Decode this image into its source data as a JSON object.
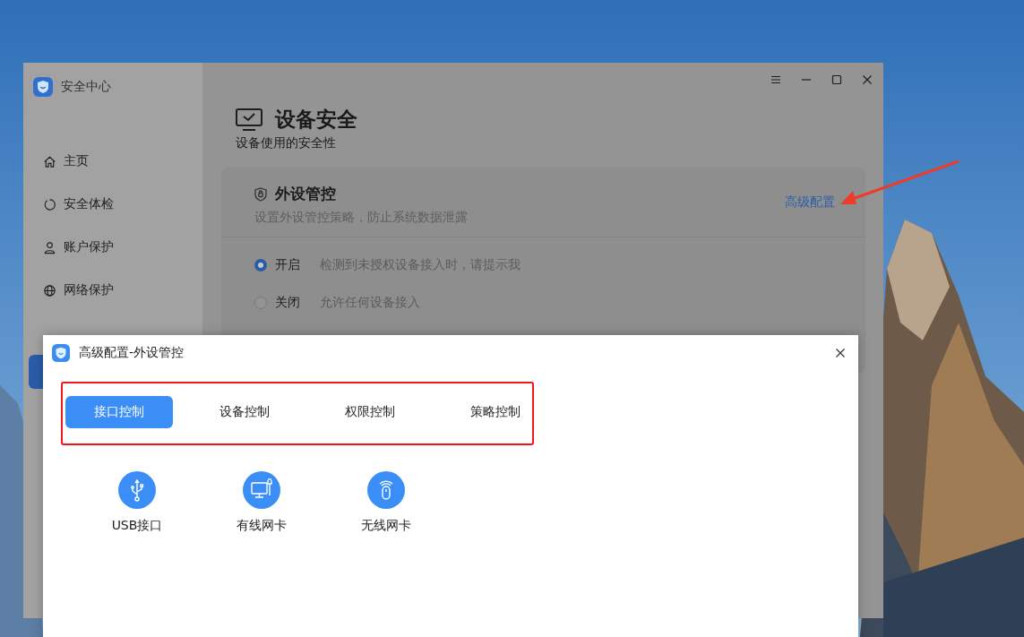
{
  "window": {
    "title": "安全中心"
  },
  "sidebar": {
    "items": [
      {
        "label": "主页"
      },
      {
        "label": "安全体检"
      },
      {
        "label": "账户保护"
      },
      {
        "label": "网络保护"
      }
    ]
  },
  "page": {
    "title": "设备安全",
    "subtitle": "设备使用的安全性"
  },
  "card": {
    "title": "外设管控",
    "description": "设置外设管控策略，防止系统数据泄露",
    "link": "高级配置",
    "options": [
      {
        "label": "开启",
        "hint": "检测到未授权设备接入时，请提示我",
        "selected": true
      },
      {
        "label": "关闭",
        "hint": "允许任何设备接入",
        "selected": false
      }
    ]
  },
  "dialog": {
    "title": "高级配置-外设管控",
    "tabs": [
      {
        "label": "接口控制",
        "selected": true
      },
      {
        "label": "设备控制",
        "selected": false
      },
      {
        "label": "权限控制",
        "selected": false
      },
      {
        "label": "策略控制",
        "selected": false
      }
    ],
    "items": [
      {
        "label": "USB接口"
      },
      {
        "label": "有线网卡"
      },
      {
        "label": "无线网卡"
      }
    ]
  }
}
